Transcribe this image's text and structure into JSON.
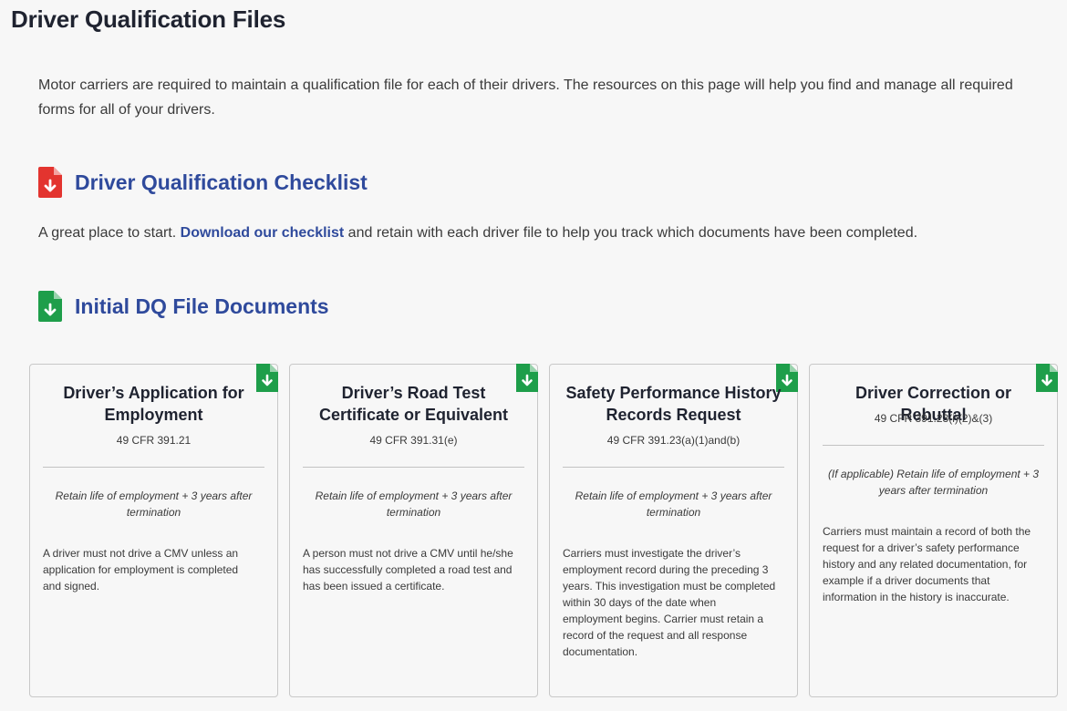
{
  "page": {
    "title": "Driver Qualification Files",
    "intro": "Motor carriers are required to maintain a qualification file for each of their drivers. The resources on this page will help you find and manage all required forms for all of your drivers."
  },
  "checklist": {
    "heading": "Driver Qualification Checklist",
    "text_before": "A great place to start. ",
    "link": "Download our checklist",
    "text_after": " and retain with each driver file to help you track which documents have been completed.",
    "icon": "pdf-download-icon",
    "icon_color": "#e3342f"
  },
  "initial": {
    "heading": "Initial DQ File Documents",
    "icon": "sheet-download-icon",
    "icon_color": "#1e9e4a"
  },
  "cards": [
    {
      "title": "Driver’s Application for Employment",
      "cfr": "49 CFR 391.21",
      "retain": "Retain life of employment + 3 years after termination",
      "description": "A driver must not drive a CMV unless an application for employment is completed and signed."
    },
    {
      "title": "Driver’s Road Test Certificate or Equivalent",
      "cfr": "49 CFR 391.31(e)",
      "retain": "Retain life of employment + 3 years after termination",
      "description": "A person must not drive a CMV until he/she has successfully completed a road test and has been issued a certificate."
    },
    {
      "title": "Safety Performance History Records Request",
      "cfr": "49 CFR 391.23(a)(1)and(b)",
      "retain": "Retain life of employment + 3 years after termination",
      "description": "Carriers must investigate the driver’s employment record during the preceding 3 years. This investigation must be completed within 30 days of the date when employment begins. Carrier must retain a record of the request and all response documentation."
    },
    {
      "title": "Driver Correction or Rebuttal",
      "cfr": "49 CFR 391.23(i)(2)&(3)",
      "retain": "(If applicable) Retain life of employment + 3 years after termination",
      "description": "Carriers must maintain a record of both the request for a driver’s safety performance history and any related documentation, for example if a driver documents that information in the history is inaccurate."
    }
  ]
}
